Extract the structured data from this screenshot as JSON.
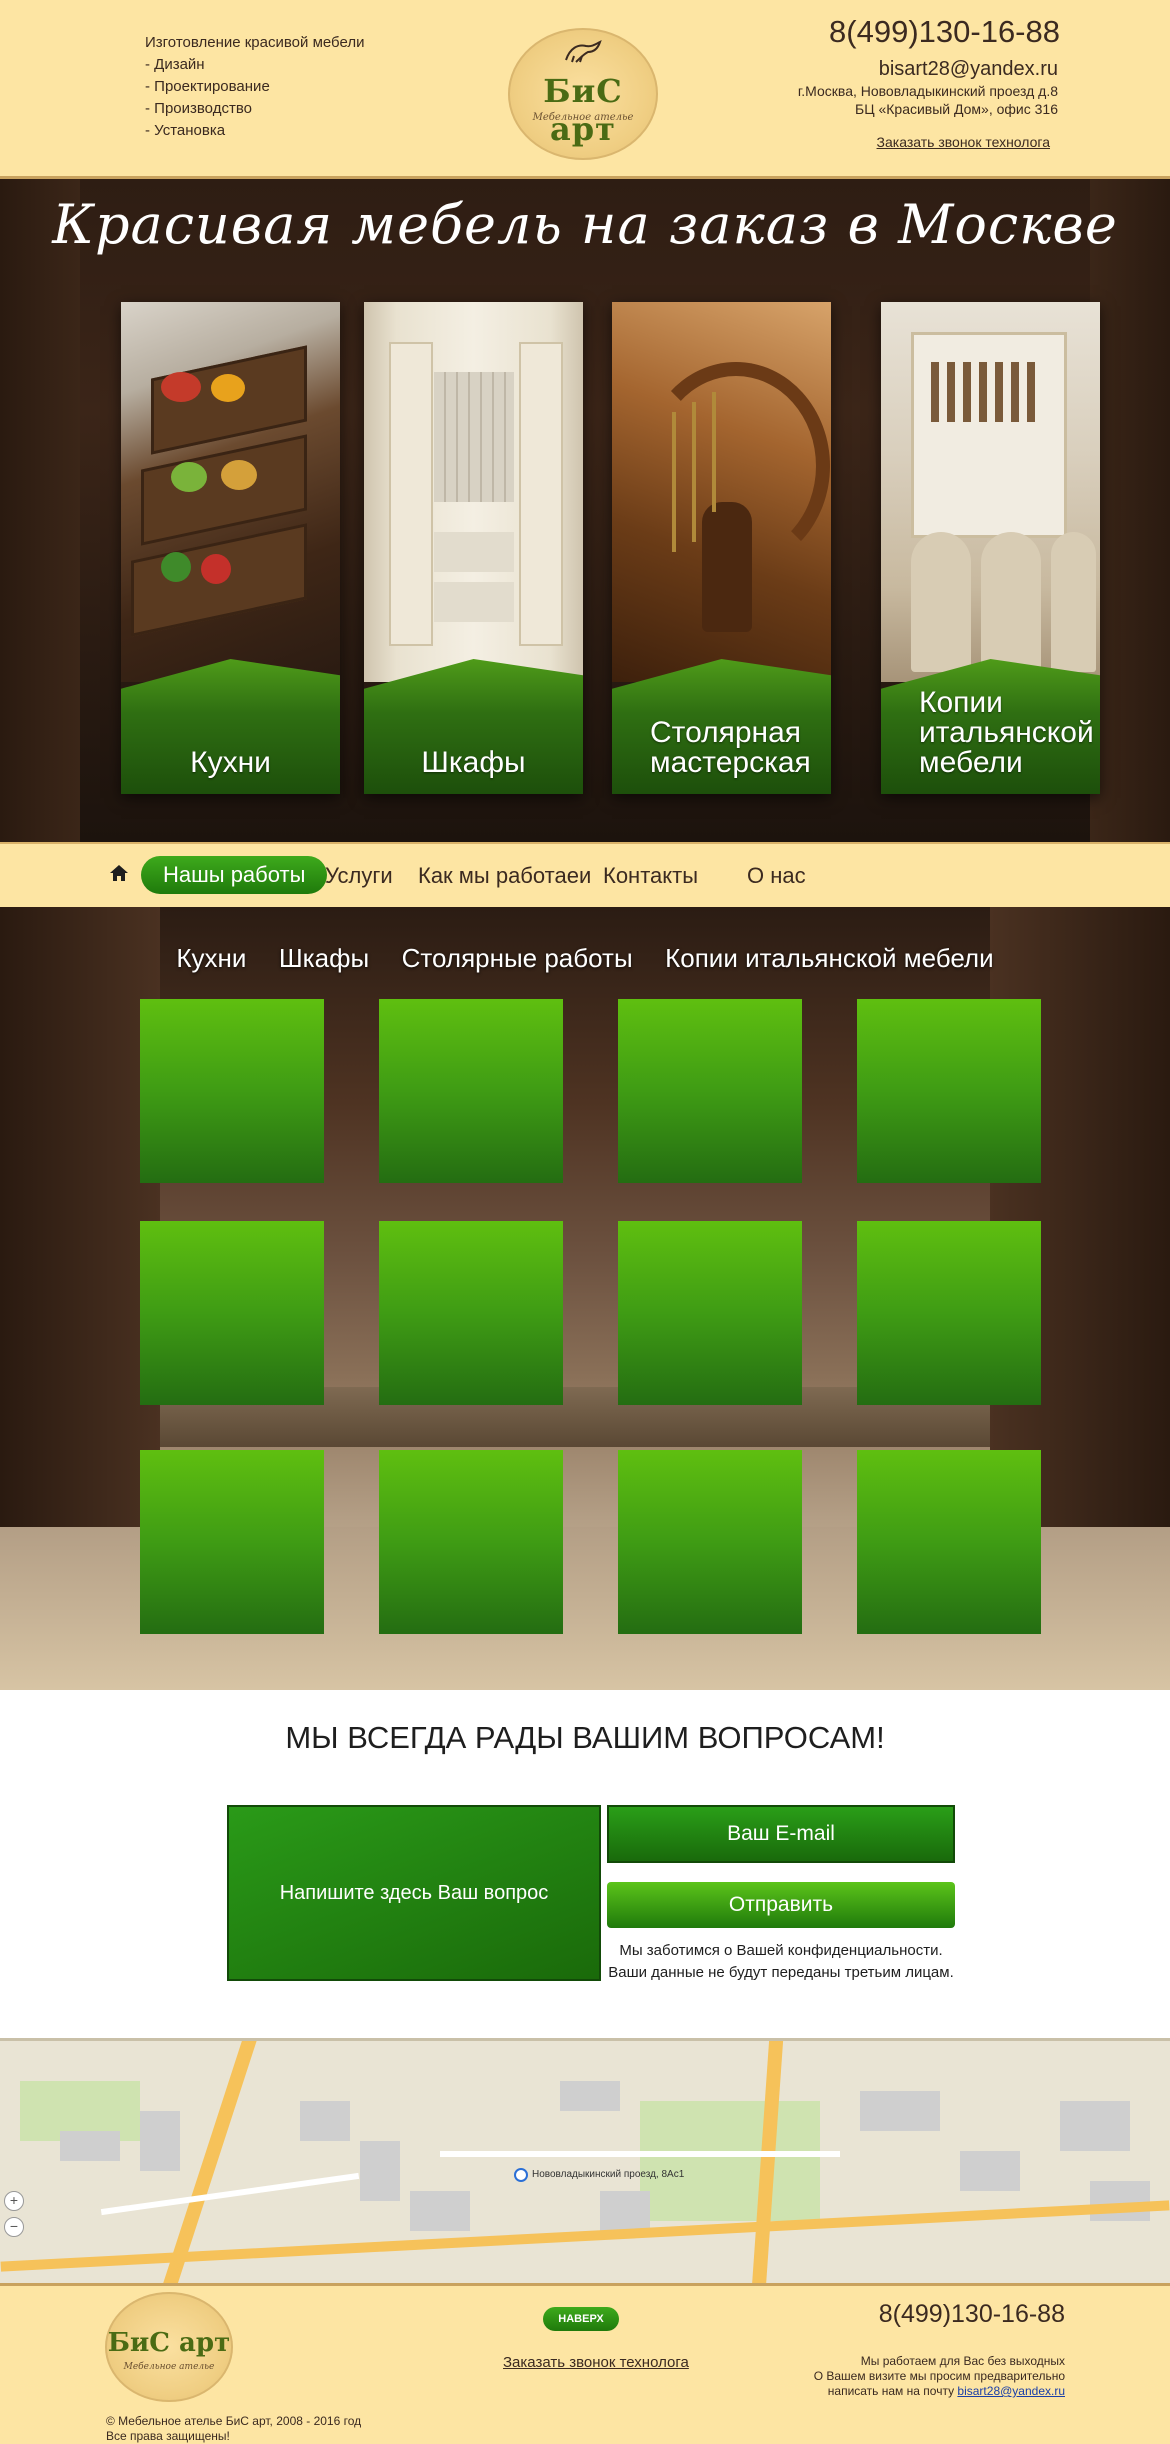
{
  "header": {
    "services": [
      "Изготовление красивой мебели",
      "- Дизайн",
      "- Проектирование",
      "- Производство",
      "- Установка"
    ],
    "logo": {
      "name": "БиС арт",
      "tagline": "Мебельное ателье"
    },
    "phone": "8(499)130-16-88",
    "email": "bisart28@yandex.ru",
    "address_line1": "г.Москва, Нововладыкинский проезд д.8",
    "address_line2": "БЦ «Красивый Дом», офис 316",
    "callback": "Заказать звонок технолога"
  },
  "hero": {
    "title": "Красивая мебель на заказ в Москве",
    "cards": [
      {
        "label_line1": "Кухни",
        "label_line2": "",
        "label_line3": ""
      },
      {
        "label_line1": "Шкафы",
        "label_line2": "",
        "label_line3": ""
      },
      {
        "label_line1": "Столярная",
        "label_line2": "мастерская",
        "label_line3": ""
      },
      {
        "label_line1": "Копии",
        "label_line2": "итальянской",
        "label_line3": "мебели"
      }
    ]
  },
  "nav": {
    "items": [
      "Нашы работы",
      "Услуги",
      "Как мы работаеи",
      "Контакты",
      "О нас"
    ],
    "active_index": 0
  },
  "portfolio": {
    "tabs": [
      "Кухни",
      "Шкафы",
      "Столярные работы",
      "Копии итальянской мебели"
    ]
  },
  "question": {
    "title": "МЫ ВСЕГДА РАДЫ ВАШИМ ВОПРОСАМ!",
    "textarea_placeholder": "Напишите здесь Ваш вопрос",
    "email_placeholder": "Ваш E-mail",
    "send_label": "Отправить",
    "privacy_line1": "Мы заботимся о Вашей конфиденциальности.",
    "privacy_line2": "Ваши данные не будут переданы третьим лицам."
  },
  "map": {
    "pin_label": "Нововладыкинский проезд, 8Ас1",
    "zoom_in": "+",
    "zoom_out": "−"
  },
  "footer": {
    "logo": {
      "name": "БиС арт",
      "tagline": "Мебельное ателье"
    },
    "copyright_line1": "© Мебельное ателье БиС арт, 2008 - 2016 год",
    "copyright_line2": "Все права защищены!",
    "top_button": "НАВЕРХ",
    "callback": "Заказать звонок технолога",
    "phone": "8(499)130-16-88",
    "note_line1": "Мы работаем для Вас без выходных",
    "note_line2": "О Вашем визите мы просим предварительно",
    "note_line3_prefix": "написать нам на почту",
    "note_email": "bisart28@yandex.ru"
  },
  "colors": {
    "header_bg": "#fde5a3",
    "accent_green": "#2f8a14",
    "tile_green": "#3f9c14",
    "brand_text": "#3b2a20"
  }
}
